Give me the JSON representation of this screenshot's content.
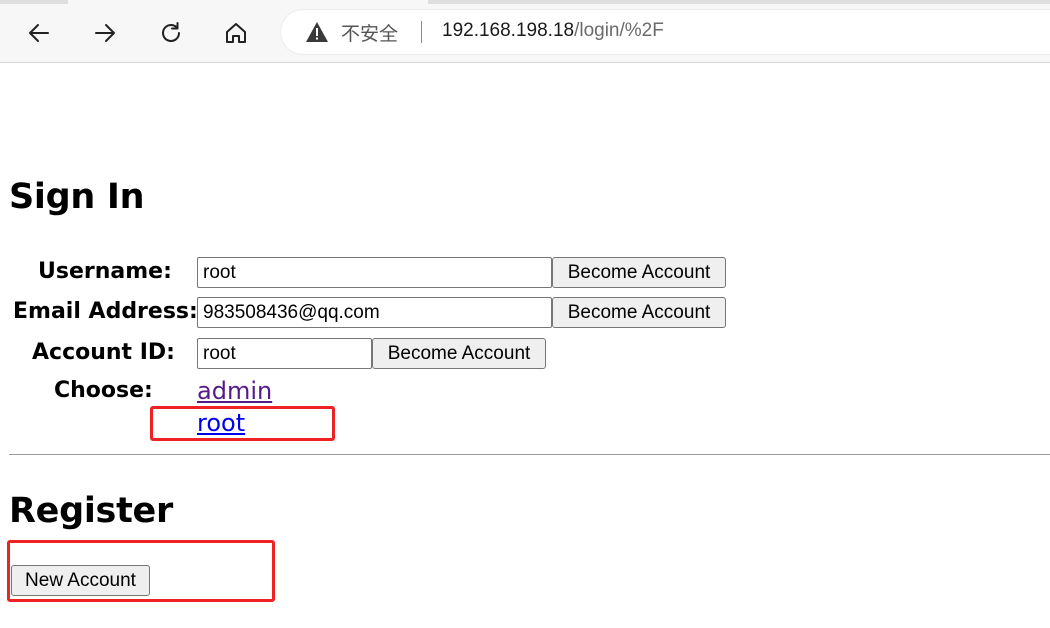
{
  "browser": {
    "security_label": "不安全",
    "url_host": "192.168.198.18",
    "url_path": "/login/%2F"
  },
  "signin": {
    "heading": "Sign In",
    "username_label": "Username:",
    "username_value": "root",
    "email_label": "Email Address:",
    "email_value": "983508436@qq.com",
    "account_id_label": "Account ID:",
    "account_id_value": "root",
    "become_label": "Become Account",
    "choose_label": "Choose:",
    "choices": [
      "admin",
      "root"
    ]
  },
  "register": {
    "heading": "Register",
    "new_account_label": "New Account"
  },
  "colors": {
    "highlight": "#ee2222",
    "link_visited": "#551a8b",
    "link_unvisited": "#0000ee"
  }
}
